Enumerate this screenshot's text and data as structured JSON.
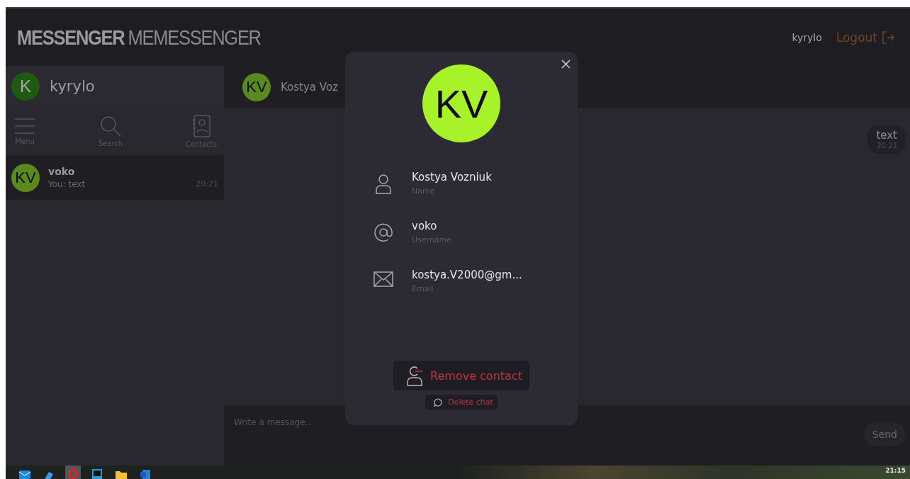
{
  "header": {
    "logo_bold": "MESSENGER",
    "logo_light": "MEMESSENGER",
    "user": "kyrylo",
    "logout": "Logout"
  },
  "profile": {
    "initial": "K",
    "name": "kyrylo"
  },
  "nav": [
    {
      "label": "Menu",
      "kind": "menu"
    },
    {
      "label": "Search",
      "kind": "search"
    },
    {
      "label": "Contacts",
      "kind": "contacts"
    }
  ],
  "chats": [
    {
      "initials": "KV",
      "name": "voko",
      "preview": "You: text",
      "time": "20:21",
      "selected": true
    }
  ],
  "chat": {
    "initials": "KV",
    "title": "Kostya Voz",
    "messages": [
      {
        "text": "text",
        "time": "20:21"
      }
    ],
    "composer": {
      "placeholder": "Write a message..",
      "button": "Send"
    }
  },
  "modal": {
    "initials": "KV",
    "fields": [
      {
        "kind": "name",
        "value": "Kostya Vozniuk",
        "label": "Name"
      },
      {
        "kind": "username",
        "value": "voko",
        "label": "Username"
      },
      {
        "kind": "email",
        "value": "kostya.V2000@gm...",
        "label": "Email"
      }
    ],
    "remove_button": "Remove contact",
    "delete_button": "Delete chat"
  },
  "taskbar": {
    "apps": [
      {
        "kind": "mail",
        "selected": false
      },
      {
        "kind": "tool",
        "selected": false
      },
      {
        "kind": "browser",
        "selected": true
      },
      {
        "kind": "ide",
        "selected": false
      },
      {
        "kind": "folder",
        "selected": false
      },
      {
        "kind": "document",
        "selected": false
      }
    ],
    "clock": "21:15"
  }
}
